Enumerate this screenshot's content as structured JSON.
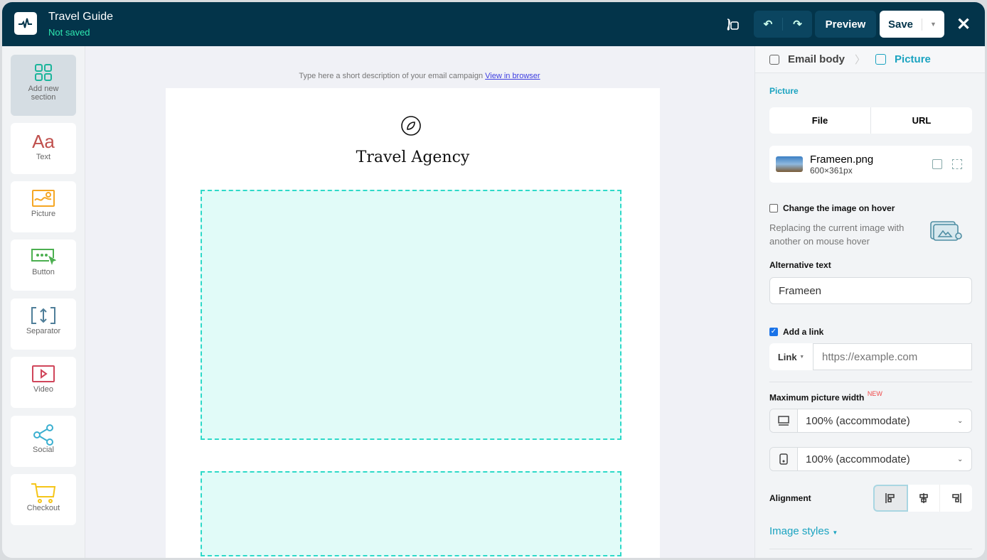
{
  "header": {
    "title": "Travel Guide",
    "status": "Not saved",
    "preview": "Preview",
    "save": "Save",
    "close": "✕"
  },
  "sidebar": {
    "items": [
      {
        "label": "Add new section"
      },
      {
        "label": "Text",
        "glyph": "Aa"
      },
      {
        "label": "Picture"
      },
      {
        "label": "Button"
      },
      {
        "label": "Separator"
      },
      {
        "label": "Video"
      },
      {
        "label": "Social"
      },
      {
        "label": "Checkout"
      }
    ]
  },
  "canvas": {
    "description": "Type here a short description of your email campaign",
    "view_link": "View in browser",
    "brand": "Travel Agency"
  },
  "panel": {
    "breadcrumb": [
      "Email body",
      "Picture"
    ],
    "section_title": "Picture",
    "source_tabs": [
      "File",
      "URL"
    ],
    "file": {
      "name": "Frameen.png",
      "size": "600×361px"
    },
    "hover": {
      "label": "Change the image on hover",
      "checked": false,
      "description": "Replacing the current image with another on mouse hover"
    },
    "alt": {
      "label": "Alternative text",
      "value": "Frameen"
    },
    "link": {
      "label": "Add a link",
      "checked": true,
      "type": "Link",
      "placeholder": "https://example.com"
    },
    "max_width": {
      "label": "Maximum picture width",
      "badge": "NEW",
      "desktop": "100% (accommodate)",
      "mobile": "100% (accommodate)"
    },
    "alignment": {
      "label": "Alignment",
      "selected": "left"
    },
    "image_styles": "Image styles"
  },
  "colors": {
    "header": "#03344a",
    "accent": "#1aa3c0",
    "dash": "#2dd9c8"
  }
}
